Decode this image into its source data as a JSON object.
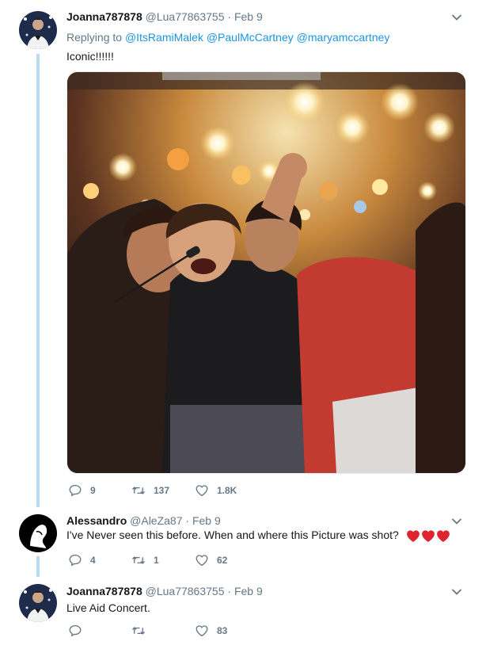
{
  "tweets": [
    {
      "name": "Joanna787878",
      "handle": "@Lua77863755",
      "separator": "·",
      "date": "Feb 9",
      "replying_prefix": "Replying to",
      "replying_to": [
        "@ItsRamiMalek",
        "@PaulMcCartney",
        "@maryamccartney"
      ],
      "text": "Iconic!!!!!!",
      "has_image": true,
      "replies": "9",
      "retweets": "137",
      "likes": "1.8K"
    },
    {
      "name": "Alessandro",
      "handle": "@AleZa87",
      "separator": "·",
      "date": "Feb 9",
      "text": "I've Never seen this before. When and where this Picture was shot?",
      "emoji_icons": [
        "red-heart-emoji-icon",
        "red-heart-emoji-icon",
        "red-heart-emoji-icon"
      ],
      "replies": "4",
      "retweets": "1",
      "likes": "62"
    },
    {
      "name": "Joanna787878",
      "handle": "@Lua77863755",
      "separator": "·",
      "date": "Feb 9",
      "text": "Live Aid Concert.",
      "replies": "",
      "retweets": "",
      "likes": "83"
    }
  ],
  "icons": {
    "reply": "reply-icon",
    "retweet": "retweet-icon",
    "like": "like-icon",
    "menu": "chevron-down-icon"
  },
  "colors": {
    "link": "#1b95e0",
    "secondary_text": "#657786",
    "thread_line": "#b8dcf2",
    "heart_emoji": "#e0242f"
  }
}
